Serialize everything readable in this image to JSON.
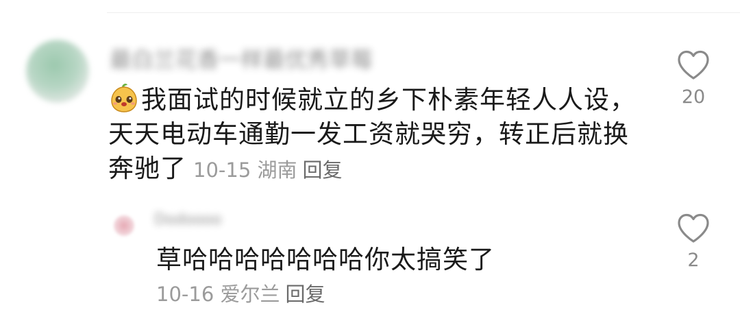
{
  "comment": {
    "username": "最白兰花香一样最优秀草莓",
    "emoji_icon": "smiling-pear-emoji",
    "text": "我面试的时候就立的乡下朴素年轻人人设，天天电动车通勤一发工资就哭穷，转正后就换奔驰了",
    "date": "10-15",
    "location": "湖南",
    "reply_label": "回复",
    "like_count": "20"
  },
  "reply": {
    "username": "Dodoooo",
    "text": "草哈哈哈哈哈哈哈你太搞笑了",
    "date": "10-16",
    "location": "爱尔兰",
    "reply_label": "回复",
    "like_count": "2"
  },
  "colors": {
    "text": "#1a1a1a",
    "meta": "#9b9b9b",
    "icon": "#8a8a8a"
  }
}
